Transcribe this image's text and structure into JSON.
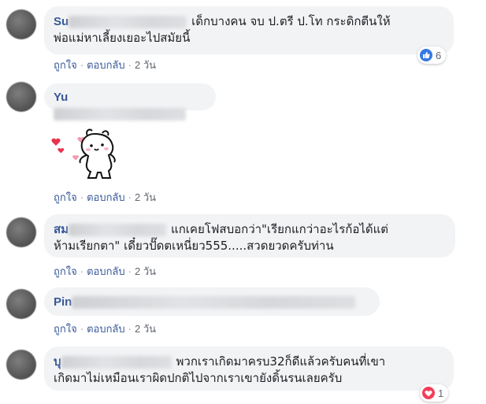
{
  "comments": [
    {
      "author_visible": "Su",
      "text": "เด็กบางคน จบ ป.ตรี ป.โท กระดิกตีนให้พ่อแม่หาเลี้ยงเยอะไปสมัยนี้",
      "text_line1": "เด็กบางคน จบ ป.ตรี ป.โท กระดิกตีนให้",
      "text_line2": "พ่อแม่หาเลี้ยงเยอะไปสมัยนี้",
      "like_label": "ถูกใจ",
      "reply_label": "ตอบกลับ",
      "time": "2 วัน",
      "reaction": {
        "type": "like",
        "count": "6",
        "color": "#3578e5"
      }
    },
    {
      "author_visible": "Yu",
      "text": "",
      "sticker": "bear-hearts-sticker",
      "like_label": "ถูกใจ",
      "reply_label": "ตอบกลับ",
      "time": "2 วัน"
    },
    {
      "author_visible": "สม",
      "text_line1": "แกเคยโฟสบอกว่า\"เรียกแกว่าอะไรก้อได้แต่",
      "text_line2": "ห้ามเรียกตา\" เดี๋ยวปั๊ดตเหนี่ยว555.....สวดยวดครับท่าน",
      "like_label": "ถูกใจ",
      "reply_label": "ตอบกลับ",
      "time": "2 วัน"
    },
    {
      "author_visible": "Pin",
      "text": "",
      "like_label": "ถูกใจ",
      "reply_label": "ตอบกลับ",
      "time": "2 วัน"
    },
    {
      "author_visible": "บุ",
      "text_line1": "พวกเราเกิดมาครบ32ก็ดีแล้วครับคนที่เขา",
      "text_line2": "เกิดมาไม่เหมือนเราผิดปกติไปจากเราเขายังดิ้นรนเลยครับ",
      "reaction": {
        "type": "love",
        "count": "1",
        "color": "#f33e58"
      }
    }
  ],
  "separator": "·",
  "colors": {
    "bubble_bg": "#f2f3f5",
    "author": "#385898",
    "meta": "#606770",
    "link": "#385898"
  }
}
